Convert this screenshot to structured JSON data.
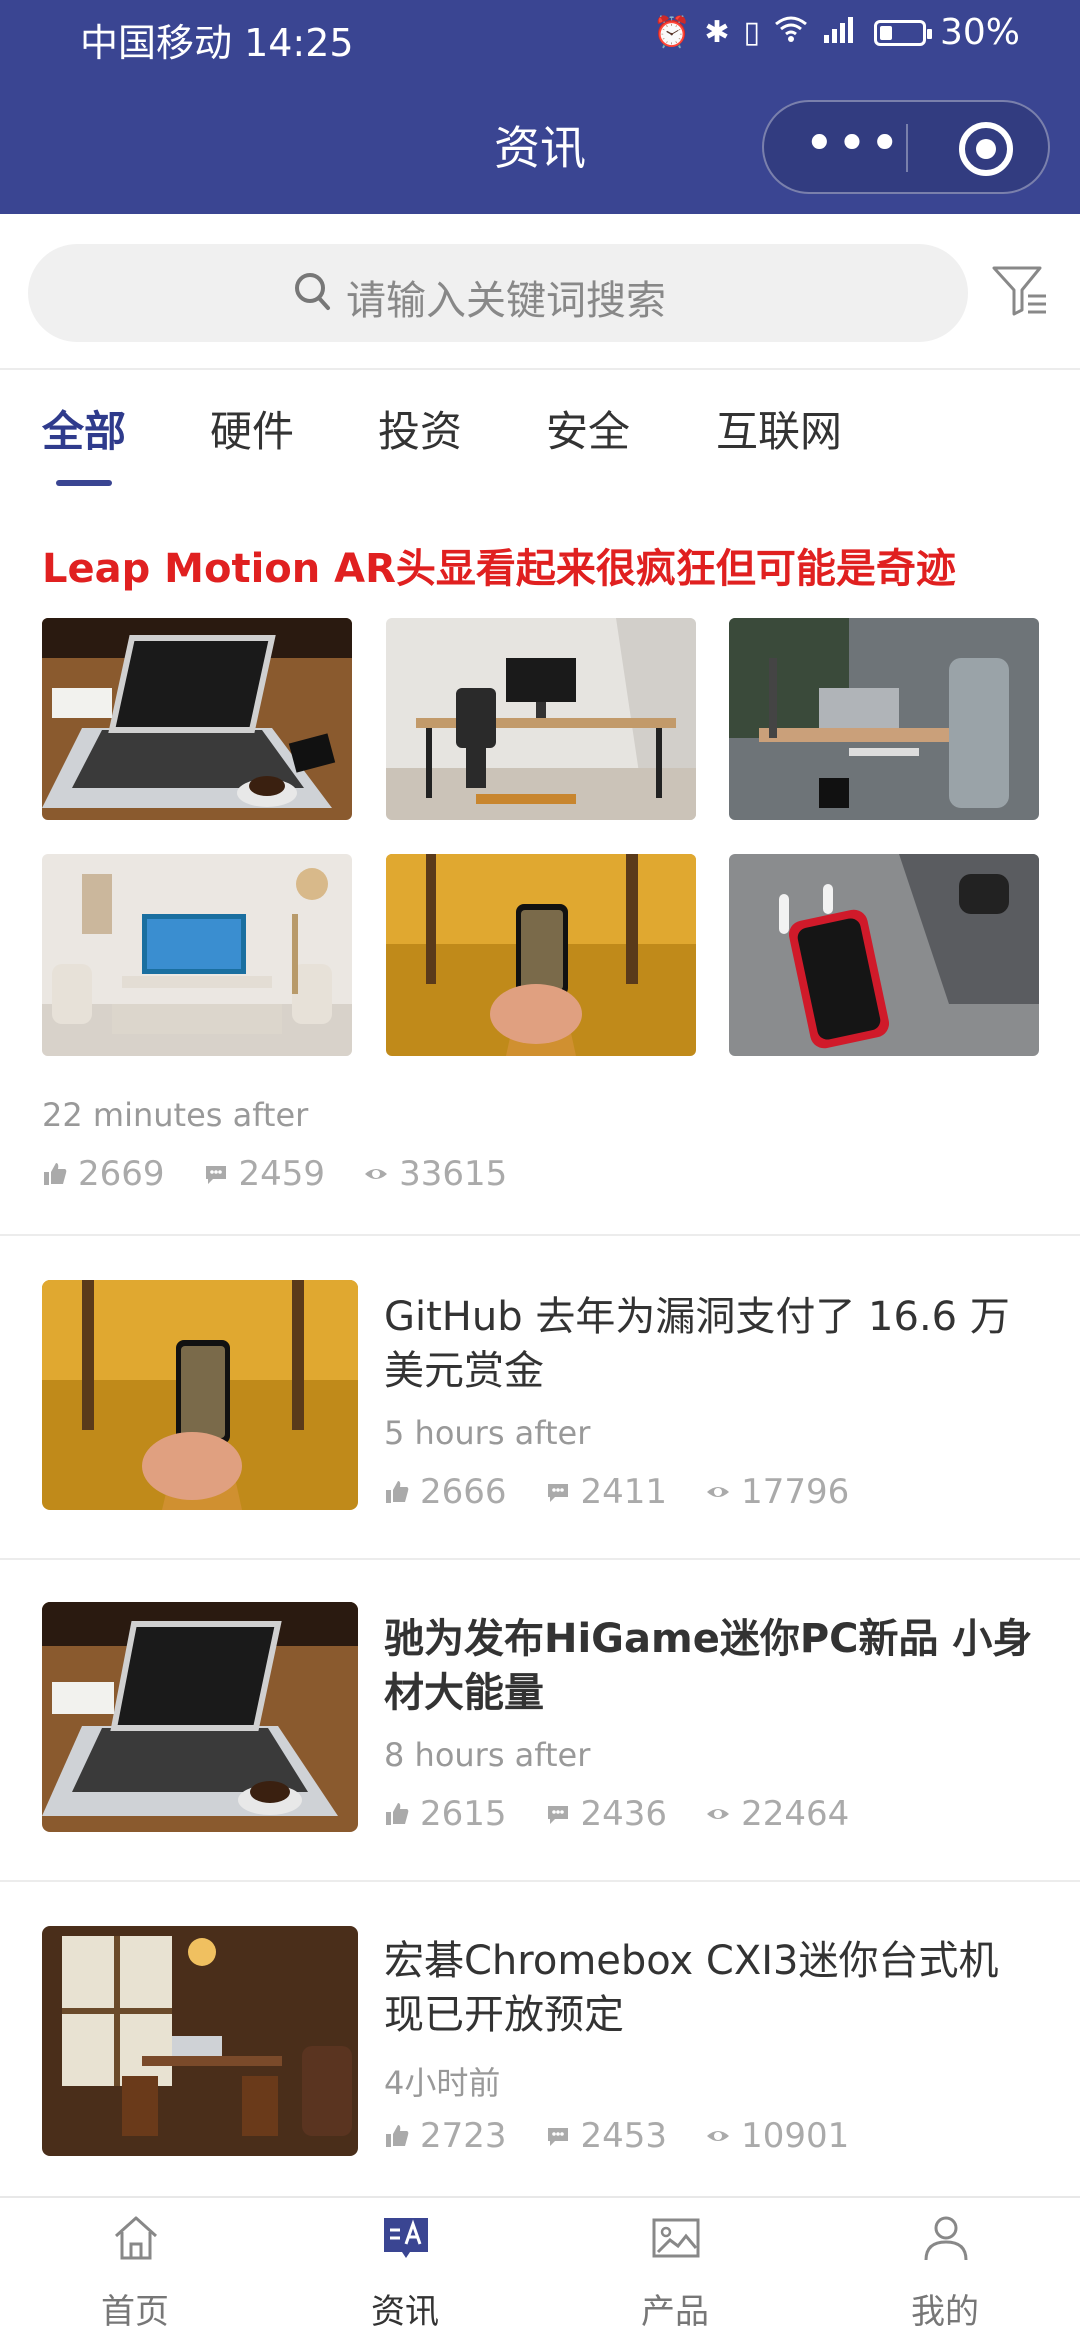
{
  "status_bar": {
    "carrier_time": "中国移动 14:25",
    "battery": "30%",
    "battery_fraction": 0.3
  },
  "header": {
    "title": "资讯"
  },
  "search": {
    "placeholder": "请输入关键词搜索"
  },
  "tabs": [
    {
      "label": "全部",
      "active": true
    },
    {
      "label": "硬件",
      "active": false
    },
    {
      "label": "投资",
      "active": false
    },
    {
      "label": "安全",
      "active": false
    },
    {
      "label": "互联网",
      "active": false
    }
  ],
  "featured": {
    "title": "Leap Motion AR头显看起来很疯狂但可能是奇迹",
    "time": "22 minutes after",
    "likes": "2669",
    "comments": "2459",
    "views": "33615"
  },
  "articles": [
    {
      "title": "GitHub 去年为漏洞支付了 16.6 万美元赏金",
      "time": "5 hours after",
      "likes": "2666",
      "comments": "2411",
      "views": "17796"
    },
    {
      "title": "驰为发布HiGame迷你PC新品 小身材大能量",
      "time": "8 hours after",
      "likes": "2615",
      "comments": "2436",
      "views": "22464"
    },
    {
      "title": "宏碁Chromebox CXI3迷你台式机现已开放预定",
      "time": "4小时前",
      "likes": "2723",
      "comments": "2453",
      "views": "10901"
    }
  ],
  "bottom_nav": [
    {
      "label": "首页",
      "icon": "home-icon",
      "active": false
    },
    {
      "label": "资讯",
      "icon": "news-icon",
      "active": true
    },
    {
      "label": "产品",
      "icon": "image-icon",
      "active": false
    },
    {
      "label": "我的",
      "icon": "user-icon",
      "active": false
    }
  ],
  "colors": {
    "brand": "#3a4592",
    "headline_red": "#e02020"
  }
}
